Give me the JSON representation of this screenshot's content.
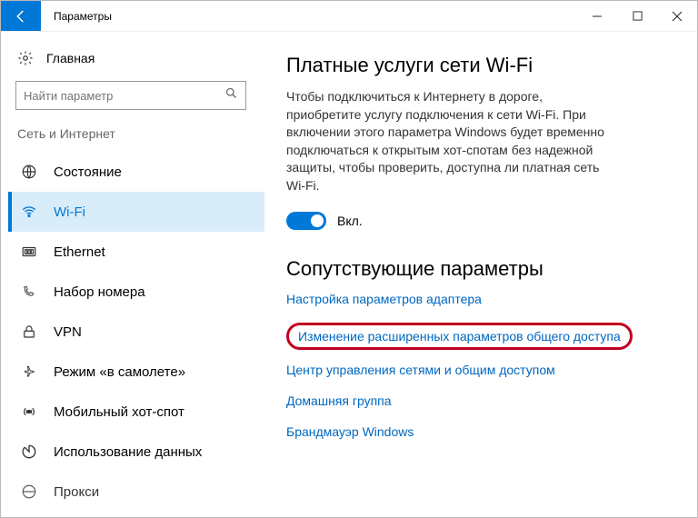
{
  "window": {
    "title": "Параметры"
  },
  "sidebar": {
    "home": "Главная",
    "search_placeholder": "Найти параметр",
    "category": "Сеть и Интернет",
    "items": [
      {
        "label": "Состояние"
      },
      {
        "label": "Wi-Fi"
      },
      {
        "label": "Ethernet"
      },
      {
        "label": "Набор номера"
      },
      {
        "label": "VPN"
      },
      {
        "label": "Режим «в самолете»"
      },
      {
        "label": "Мобильный хот-спот"
      },
      {
        "label": "Использование данных"
      },
      {
        "label": "Прокси"
      }
    ]
  },
  "main": {
    "heading1": "Платные услуги сети Wi-Fi",
    "paragraph": "Чтобы подключиться к Интернету в дороге, приобретите услугу подключения к сети Wi-Fi. При включении этого параметра Windows будет временно подключаться к открытым хот-спотам без надежной защиты, чтобы проверить, доступна ли платная сеть Wi-Fi.",
    "toggle_label": "Вкл.",
    "heading2": "Сопутствующие параметры",
    "links": {
      "adapter": "Настройка параметров адаптера",
      "sharing": "Изменение расширенных параметров общего доступа",
      "center": "Центр управления сетями и общим доступом",
      "homegroup": "Домашняя группа",
      "firewall": "Брандмауэр Windows"
    }
  }
}
